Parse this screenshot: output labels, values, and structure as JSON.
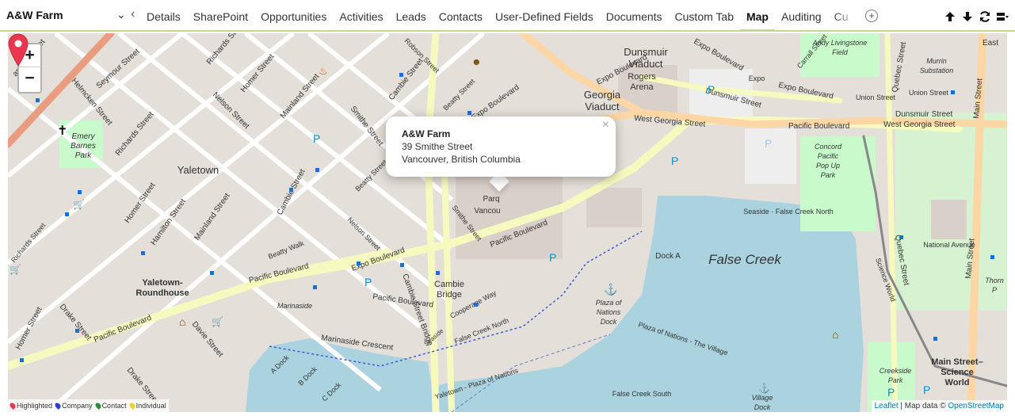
{
  "header": {
    "record_title": "A&W Farm",
    "tabs": [
      "Details",
      "SharePoint",
      "Opportunities",
      "Activities",
      "Leads",
      "Contacts",
      "User-Defined Fields",
      "Documents",
      "Custom Tab",
      "Map",
      "Auditing",
      "Cu"
    ],
    "active_tab": "Map",
    "add_tab_symbol": "+",
    "tool_icons": [
      "arrow-up-icon",
      "arrow-down-icon",
      "refresh-icon",
      "layout-icon"
    ]
  },
  "map": {
    "zoom_in": "+",
    "zoom_out": "−",
    "popup": {
      "name": "A&W Farm",
      "street": "39 Smithe Street",
      "city": "Vancouver, British Columbia",
      "close": "×"
    },
    "marker_color": "#e8374f",
    "place_labels": {
      "dunsmuir_viaduct_1": "Dunsmuir",
      "dunsmuir_viaduct_2": "Viaduct",
      "georgia_viaduct_1": "Georgia",
      "georgia_viaduct_2": "Viaduct",
      "rogers_arena_1": "Rogers",
      "rogers_arena_2": "Arena",
      "yaletown": "Yaletown",
      "false_creek": "False Creek",
      "emery_barnes_1": "Emery",
      "emery_barnes_2": "Barnes",
      "emery_barnes_3": "Park",
      "yaletown_roundhouse_1": "Yaletown-",
      "yaletown_roundhouse_2": "Roundhouse",
      "cambie_bridge_1": "Cambie",
      "cambie_bridge_2": "Bridge",
      "concord_1": "Concord",
      "concord_2": "Pacific",
      "concord_3": "Pop Up",
      "concord_4": "Park",
      "andy_1": "Andy Livingstone",
      "andy_2": "Field",
      "murrin_1": "Murrin",
      "murrin_2": "Substation",
      "dock_a": "Dock A",
      "plaza_1": "Plaza of",
      "plaza_2": "Nations",
      "plaza_3": "Dock",
      "main_science_1": "Main Street–",
      "main_science_2": "Science",
      "main_science_3": "World",
      "marinaside": "Marinaside",
      "beatty_walk": "Beatty Walk",
      "cooperage_way": "Cooperage Way",
      "a_dock": "A Dock",
      "b_dock": "B Dock",
      "c_dock": "C Dock",
      "creekside_1": "Creekside",
      "creekside_2": "Park",
      "village_1": "Village",
      "village_2": "Dock",
      "false_creek_north": "False Creek North",
      "false_creek_south": "False Creek South",
      "seaside_fcn": "Seaside · False Creek North",
      "plaza_nations_village": "Plaza of Nations - The Village",
      "yaletown_plaza": "Yaletown - Plaza of Nations",
      "parq_1": "Parq",
      "parq_2": "Vancou",
      "thorn_1": "Thorn",
      "thorn_2": "P",
      "east": "East",
      "marinaside_crescent": "Marinaside Crescent",
      "national_avenue": "National Avenue",
      "union_street": "Union Street",
      "expo": "Expo",
      "seaside": "Seaside"
    },
    "street_labels": {
      "pacific_blvd": "Pacific Boulevard",
      "expo_blvd": "Expo Boulevard",
      "west_georgia": "West Georgia Street",
      "dunsmuir_st": "Dunsmuir Street",
      "smithe_st": "Smithe Street",
      "nelson_st": "Nelson Street",
      "cambie_st": "Cambie Street",
      "cambie_bridge": "Cambie Street Bridge",
      "beatty_st": "Beatty Street",
      "hamilton_st": "Hamilton Street",
      "mainland_st": "Mainland Street",
      "homer_st": "Homer Street",
      "richards_st": "Richards Street",
      "seymour_st": "Seymour Street",
      "robson_st": "Robson Street",
      "helmcken_st": "Helmcken Street",
      "davie_st": "Davie Street",
      "drake_st": "Drake Street",
      "granville_st": "anville Street",
      "quebec_st": "Quebec Street",
      "main_st": "Main Street",
      "carrall_st": "Carrall Street",
      "union_st": "Union Street",
      "science_world": "Science World"
    }
  },
  "legend": {
    "items": [
      {
        "label": "Highlighted",
        "color": "#e8374f"
      },
      {
        "label": "Company",
        "color": "#2a3fd1"
      },
      {
        "label": "Contact",
        "color": "#2a8f3a"
      },
      {
        "label": "Individual",
        "color": "#f2d22e"
      }
    ]
  },
  "attribution": {
    "leaflet": "Leaflet",
    "separator": "| Map data ©",
    "osm": "OpenStreetMap"
  }
}
